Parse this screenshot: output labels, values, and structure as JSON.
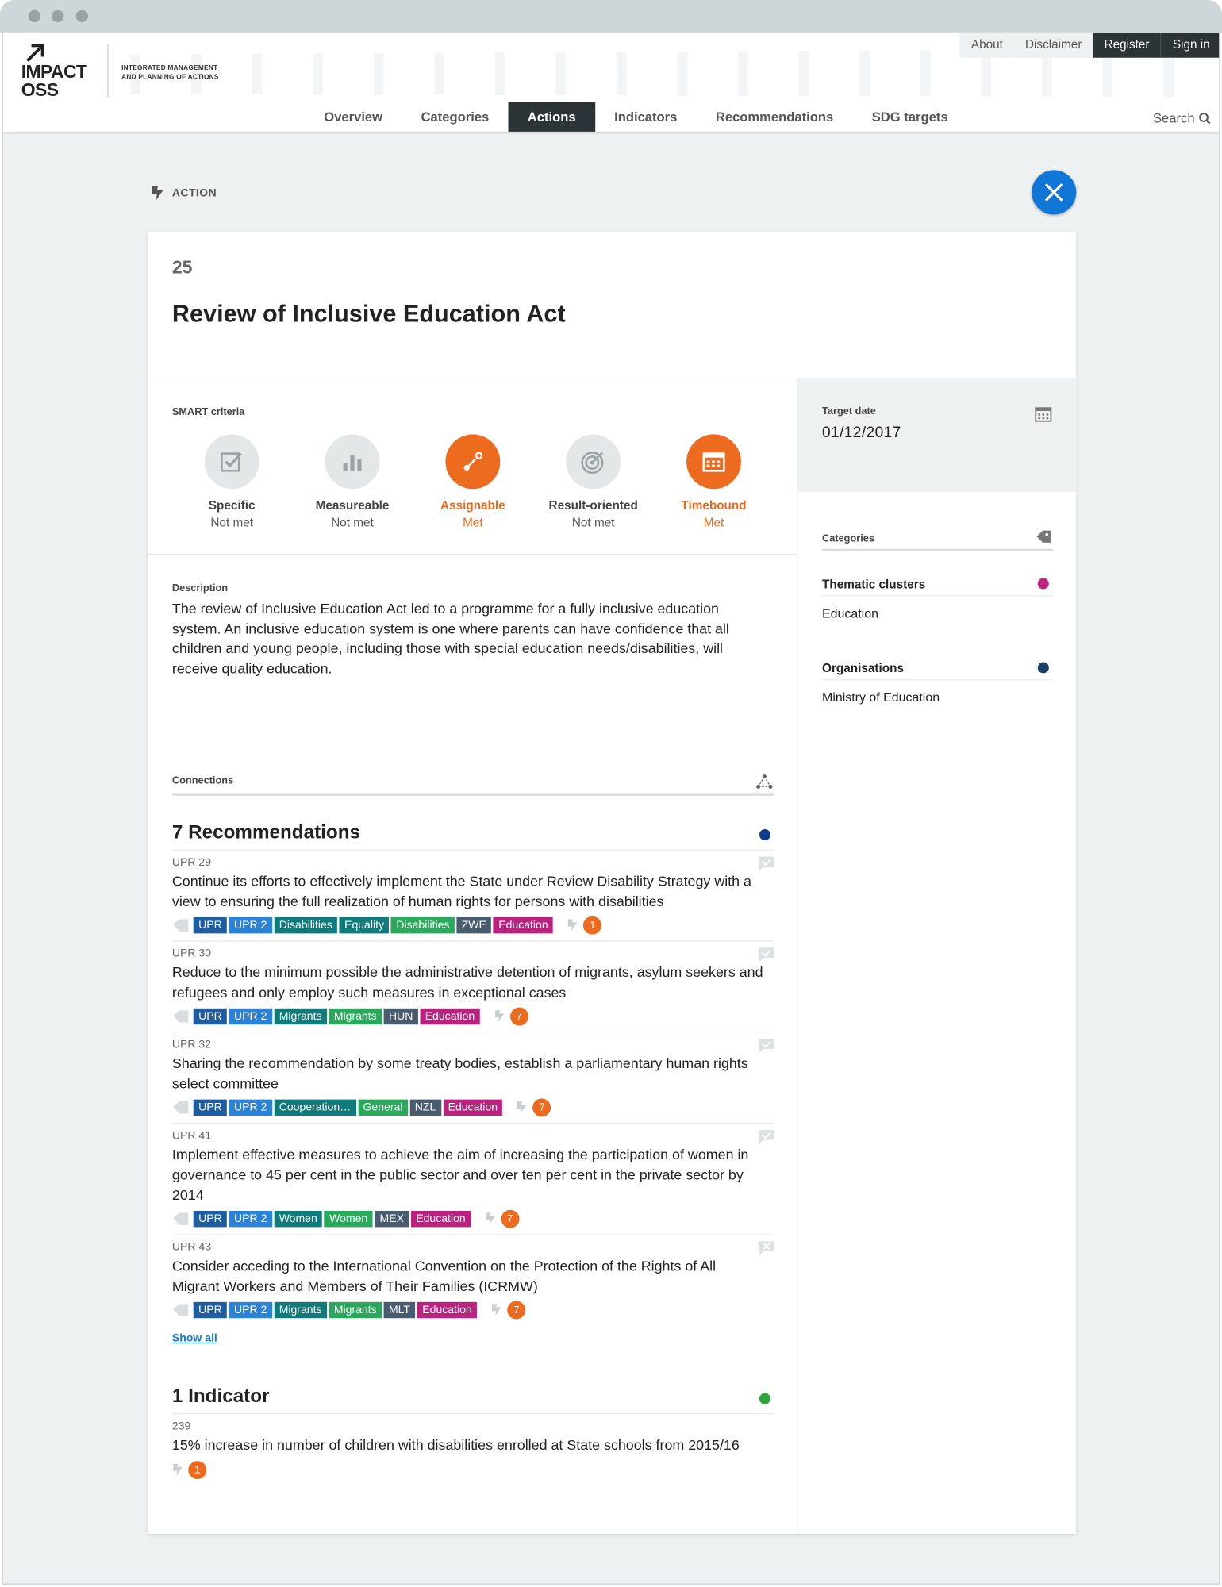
{
  "nav": {
    "top": [
      "About",
      "Disclaimer",
      "Register",
      "Sign in"
    ],
    "main": [
      "Overview",
      "Categories",
      "Actions",
      "Indicators",
      "Recommendations",
      "SDG targets"
    ],
    "active": "Actions",
    "search": "Search"
  },
  "brand": {
    "logo_line1": "IMPACT",
    "logo_line2": "OSS",
    "tagline_line1": "INTEGRATED MANAGEMENT",
    "tagline_line2": "AND PLANNING OF ACTIONS"
  },
  "page": {
    "type_label": "ACTION",
    "ref": "25",
    "title": "Review of Inclusive Education Act"
  },
  "smart": {
    "label": "SMART criteria",
    "criteria": [
      {
        "name": "Specific",
        "status": "Not met",
        "met": false,
        "icon": "checkbox-icon"
      },
      {
        "name": "Measureable",
        "status": "Not met",
        "met": false,
        "icon": "bar-chart-icon"
      },
      {
        "name": "Assignable",
        "status": "Met",
        "met": true,
        "icon": "connect-icon"
      },
      {
        "name": "Result-oriented",
        "status": "Not met",
        "met": false,
        "icon": "target-icon"
      },
      {
        "name": "Timebound",
        "status": "Met",
        "met": true,
        "icon": "calendar-icon"
      }
    ]
  },
  "description": {
    "label": "Description",
    "text": "The review of Inclusive Education Act led to a programme for a fully inclusive education system. An inclusive education system is one where parents can have confidence that all children and young people, including those with special education needs/disabilities, will receive quality education."
  },
  "connections": {
    "label": "Connections",
    "recommendations": {
      "title": "7 Recommendations",
      "color": "#0f3f8c",
      "items": [
        {
          "id": "UPR 29",
          "text": "Continue its efforts to effectively implement the State under Review Disability Strategy with a view to ensuring the full realization of human rights for persons with disabilities",
          "tags": [
            "UPR",
            "UPR 2",
            "Disabilities",
            "Equality",
            "Disabilities",
            "ZWE",
            "Education"
          ],
          "count": "1"
        },
        {
          "id": "UPR 30",
          "text": "Reduce to the minimum possible the administrative detention of migrants, asylum seekers and refugees and only employ such measures in exceptional cases",
          "tags": [
            "UPR",
            "UPR 2",
            "Migrants",
            "Migrants",
            "HUN",
            "Education"
          ],
          "count": "7"
        },
        {
          "id": "UPR 32",
          "text": "Sharing the recommendation by some treaty bodies, establish a parliamentary human rights select committee",
          "tags": [
            "UPR",
            "UPR 2",
            "Cooperation…",
            "General",
            "NZL",
            "Education"
          ],
          "count": "7"
        },
        {
          "id": "UPR 41",
          "text": "Implement effective measures to achieve the aim of increasing the participation of women in governance to 45 per cent in the public sector and over ten per cent in the private sector by 2014",
          "tags": [
            "UPR",
            "UPR 2",
            "Women",
            "Women",
            "MEX",
            "Education"
          ],
          "count": "7"
        },
        {
          "id": "UPR 43",
          "text": "Consider acceding to the International Convention on the Protection of the Rights of All Migrant Workers and Members of Their Families (ICRMW)",
          "tags": [
            "UPR",
            "UPR 2",
            "Migrants",
            "Migrants",
            "MLT",
            "Education"
          ],
          "count": "7"
        }
      ],
      "show_all": "Show all"
    },
    "indicators": {
      "title": "1 Indicator",
      "color": "#2aa53a",
      "items": [
        {
          "id": "239",
          "text": "15% increase in number of children with disabilities enrolled at State schools from 2015/16",
          "count": "1"
        }
      ]
    }
  },
  "sidebar": {
    "target_label": "Target date",
    "target_value": "01/12/2017",
    "categories_label": "Categories",
    "groups": [
      {
        "title": "Thematic clusters",
        "value": "Education",
        "color": "#c0267f"
      },
      {
        "title": "Organisations",
        "value": "Ministry of Education",
        "color": "#1b3f66"
      }
    ]
  }
}
